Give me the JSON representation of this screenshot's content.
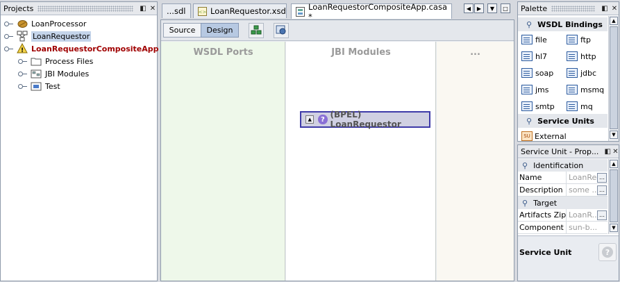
{
  "projects": {
    "title": "Projects",
    "items": [
      {
        "label": "LoanProcessor",
        "icon": "bean-icon",
        "selected": false,
        "bold": false
      },
      {
        "label": "LoanRequestor",
        "icon": "module-icon",
        "selected": true,
        "bold": false
      },
      {
        "label": "LoanRequestorCompositeApp",
        "icon": "composite-app-icon",
        "selected": false,
        "bold": true
      },
      {
        "label": "Process Files",
        "icon": "folder-icon",
        "selected": false,
        "bold": false
      },
      {
        "label": "JBI Modules",
        "icon": "jbi-modules-icon",
        "selected": false,
        "bold": false
      },
      {
        "label": "Test",
        "icon": "test-icon",
        "selected": false,
        "bold": false
      }
    ]
  },
  "editor": {
    "tabs": [
      {
        "label": "...sdl",
        "active": false
      },
      {
        "label": "LoanRequestor.xsd",
        "active": false
      },
      {
        "label": "LoanRequestorCompositeApp.casa *",
        "active": true
      }
    ],
    "toolbar": {
      "source_label": "Source",
      "design_label": "Design"
    },
    "columns": {
      "wsdl_ports": "WSDL Ports",
      "jbi_modules": "JBI Modules",
      "external": "..."
    },
    "module_node": {
      "label": "(BPEL) LoanRequestor"
    }
  },
  "palette": {
    "title": "Palette",
    "sections": {
      "wsdl_bindings": "WSDL Bindings",
      "service_units": "Service Units"
    },
    "bindings": [
      "file",
      "ftp",
      "hl7",
      "http",
      "soap",
      "jdbc",
      "jms",
      "msmq",
      "smtp",
      "mq"
    ],
    "service_units": [
      "External"
    ]
  },
  "properties": {
    "title": "Service Unit - Prop...",
    "sections": {
      "identification": "Identification",
      "target": "Target"
    },
    "rows": [
      {
        "name": "Name",
        "value": "LoanReq..."
      },
      {
        "name": "Description",
        "value": "some ..."
      },
      {
        "name": "Artifacts Zip",
        "value": "LoanR..."
      },
      {
        "name": "Component Na",
        "value": "sun-b..."
      }
    ],
    "footer": "Service Unit"
  },
  "colors": {
    "selection": "#c4d4ea",
    "composite_text": "#a00000",
    "wsdl_column": "#eef8ea",
    "external_column": "#faf8f2",
    "node_border": "#3e3aa8",
    "node_fill": "#d0d0e2"
  }
}
